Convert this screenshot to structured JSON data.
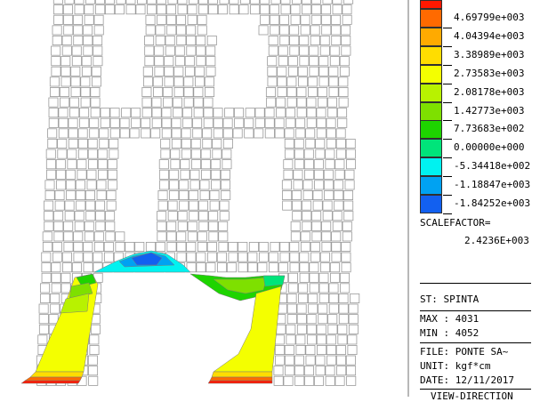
{
  "legend": {
    "levels": [
      {
        "value": "4.69799e+003",
        "color": "#ff6a00"
      },
      {
        "value": "4.04394e+003",
        "color": "#ffaa00"
      },
      {
        "value": "3.38989e+003",
        "color": "#ffdd00"
      },
      {
        "value": "2.73583e+003",
        "color": "#f4ff00"
      },
      {
        "value": "2.08178e+003",
        "color": "#b8f200"
      },
      {
        "value": "1.42773e+003",
        "color": "#7ee000"
      },
      {
        "value": "7.73683e+002",
        "color": "#1ed400"
      },
      {
        "value": "0.00000e+000",
        "color": "#00e47a"
      },
      {
        "value": "-5.34418e+002",
        "color": "#00f2f0"
      },
      {
        "value": "-1.18847e+003",
        "color": "#00a2f2"
      },
      {
        "value": "-1.84252e+003",
        "color": "#1260f0"
      }
    ],
    "top_color": "#ff1800"
  },
  "info": {
    "scale_label": "SCALEFACTOR=",
    "scale_value": "2.4236E+003",
    "stage": "ST: SPINTA",
    "max": "MAX : 4031",
    "min": "MIN : 4052",
    "file": "FILE: PONTE SA~",
    "unit": "UNIT: kgf*cm",
    "date": "DATE: 12/11/2017",
    "view_direction": "VIEW-DIRECTION"
  }
}
